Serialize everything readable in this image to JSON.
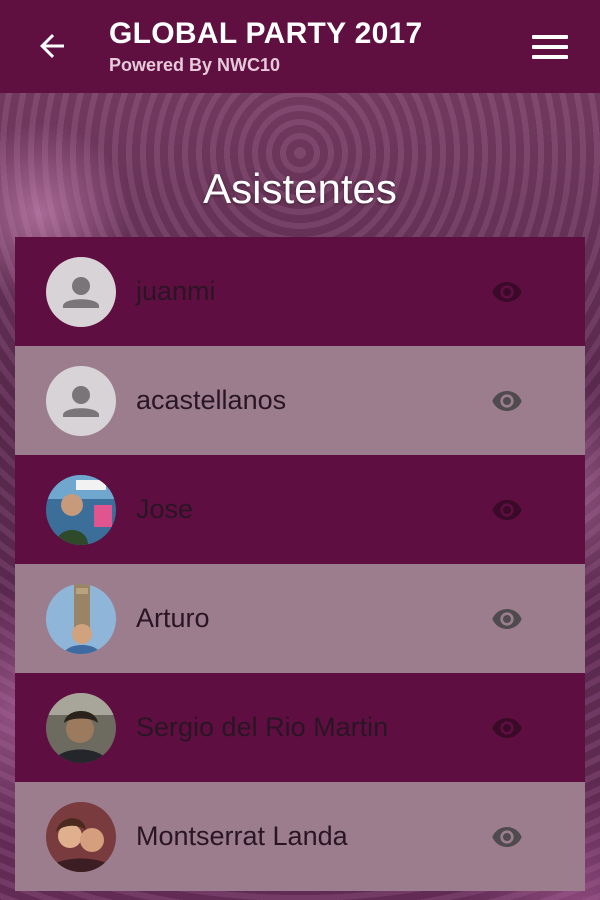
{
  "header": {
    "title": "GLOBAL PARTY 2017",
    "subtitle": "Powered By NWC10",
    "back_icon": "arrow-back-icon",
    "menu_icon": "hamburger-menu-icon"
  },
  "section": {
    "title": "Asistentes"
  },
  "attendees": [
    {
      "name": "juanmi",
      "avatar": "placeholder"
    },
    {
      "name": "acastellanos",
      "avatar": "placeholder"
    },
    {
      "name": "Jose",
      "avatar": "photo"
    },
    {
      "name": "Arturo",
      "avatar": "photo"
    },
    {
      "name": "Sergio del Rio Martin",
      "avatar": "photo"
    },
    {
      "name": "Montserrat Landa",
      "avatar": "photo"
    }
  ],
  "colors": {
    "appbar": "#5f0f40",
    "row_dark": "#5e0e40",
    "row_light": "#9b7d8e",
    "eye_on_dark": "#3a0a28",
    "eye_on_light": "#4e4a4d"
  }
}
